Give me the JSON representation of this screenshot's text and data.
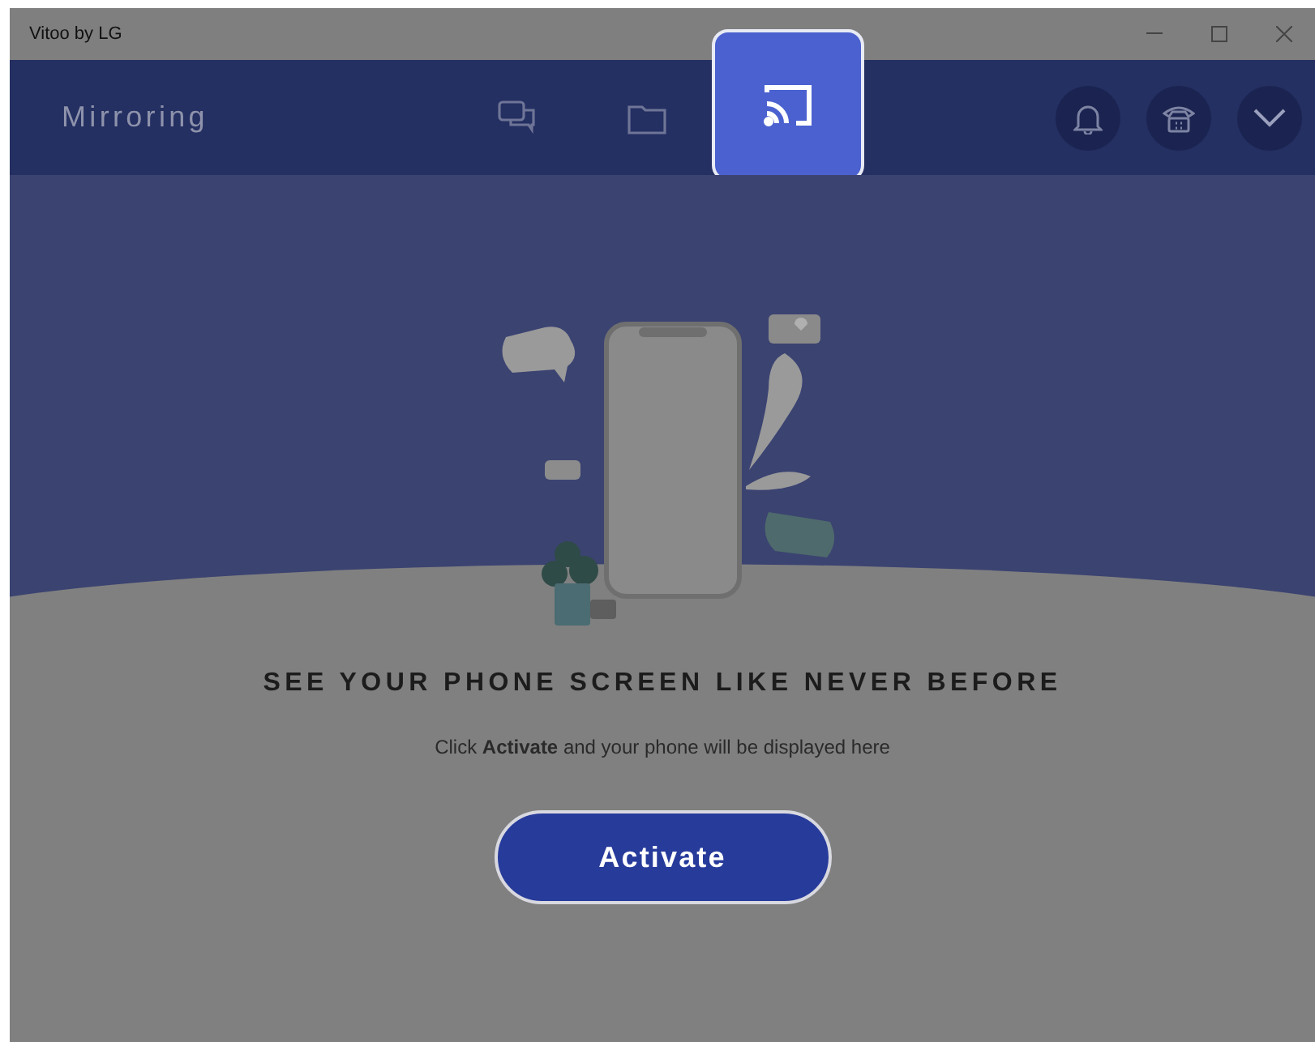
{
  "window": {
    "title": "Vitoo by LG"
  },
  "header": {
    "title": "Mirroring"
  },
  "tabs": [
    {
      "kind": "chat",
      "selected": false
    },
    {
      "kind": "folder",
      "selected": false
    },
    {
      "kind": "cast",
      "selected": true
    }
  ],
  "actions": [
    {
      "kind": "bell"
    },
    {
      "kind": "phone"
    },
    {
      "kind": "chevron"
    }
  ],
  "content": {
    "headline": "SEE YOUR PHONE SCREEN LIKE NEVER BEFORE",
    "message": "Click **Activate** and your phone will be displayed here",
    "button": "Activate"
  }
}
